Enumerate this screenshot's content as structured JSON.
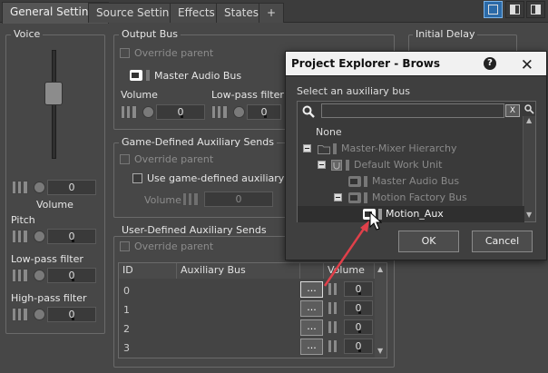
{
  "tabs": [
    "General Settings",
    "Source Settings",
    "Effects",
    "States",
    "+"
  ],
  "voice": {
    "title": "Voice",
    "volume_value": "0",
    "volume_label": "Volume",
    "pitch_label": "Pitch",
    "pitch_value": "0",
    "lowpass_label": "Low-pass filter",
    "lowpass_value": "0",
    "highpass_label": "High-pass filter",
    "highpass_value": "0"
  },
  "output_bus": {
    "title": "Output Bus",
    "override_label": "Override parent",
    "bus_name": "Master Audio Bus",
    "volume_label": "Volume",
    "volume_value": "0",
    "lowpass_label": "Low-pass filter",
    "lowpass_value": "0"
  },
  "initial_delay": {
    "title": "Initial Delay"
  },
  "game_sends": {
    "title": "Game-Defined Auxiliary Sends",
    "override_label": "Override parent",
    "use_label": "Use game-defined auxiliary sends",
    "volume_label": "Volume",
    "volume_value": "0"
  },
  "user_sends": {
    "title": "User-Defined Auxiliary Sends",
    "override_label": "Override parent",
    "columns": [
      "ID",
      "Auxiliary Bus",
      "",
      "Volume"
    ],
    "rows": [
      {
        "id": "0",
        "btn": "...",
        "vol": "0"
      },
      {
        "id": "1",
        "btn": "...",
        "vol": "0"
      },
      {
        "id": "2",
        "btn": "...",
        "vol": "0"
      },
      {
        "id": "3",
        "btn": "...",
        "vol": "0"
      }
    ]
  },
  "dialog": {
    "title": "Project Explorer - Brows",
    "help": "?",
    "close": "✕",
    "prompt": "Select an auxiliary bus",
    "search_clear": "X",
    "tree": {
      "none": "None",
      "hierarchy": "Master-Mixer Hierarchy",
      "work_unit": "Default Work Unit",
      "master_bus": "Master Audio Bus",
      "motion_factory": "Motion Factory Bus",
      "motion_aux": "Motion_Aux"
    },
    "ok": "OK",
    "cancel": "Cancel"
  },
  "colors": {
    "arrow": "#e0404a",
    "selection": "#2f2f2f",
    "active_layout": "#2b6aa8"
  }
}
